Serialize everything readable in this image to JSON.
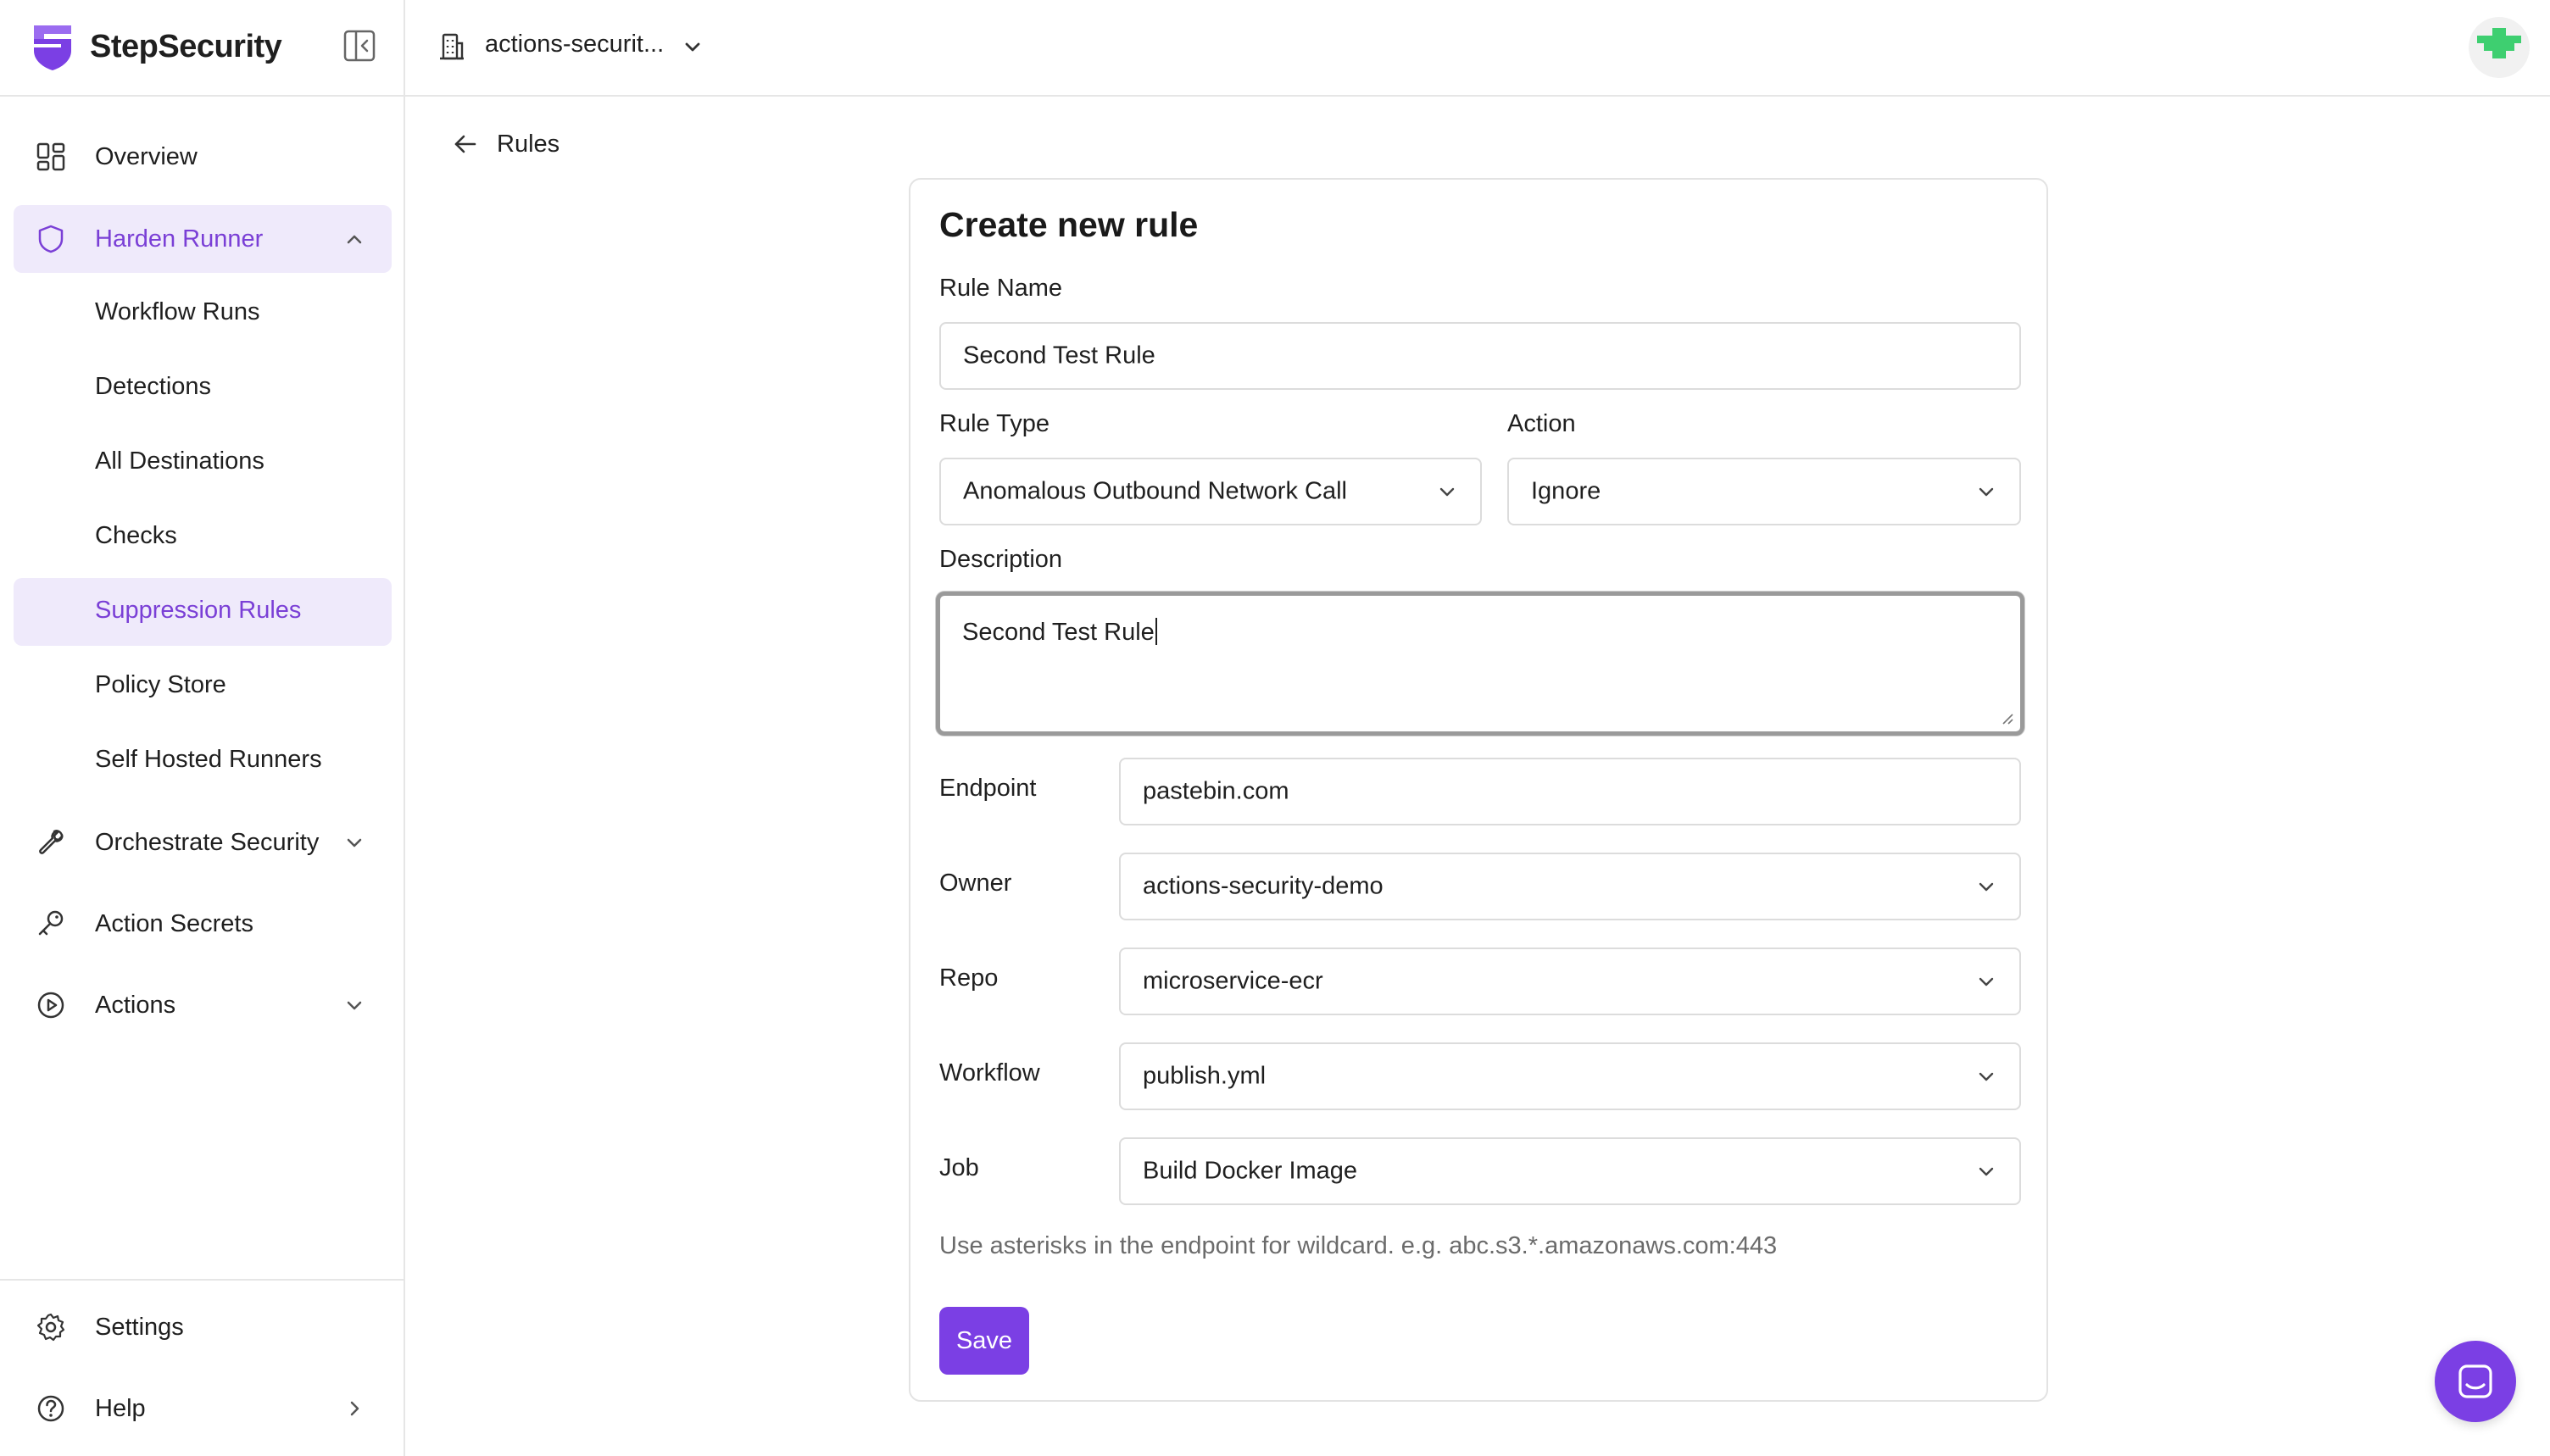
{
  "app": {
    "brand": "StepSecurity",
    "accent": "#7b3fe4"
  },
  "topbar": {
    "org_name": "actions-securit..."
  },
  "sidebar": {
    "items": [
      {
        "label": "Overview",
        "icon": "grid-icon"
      },
      {
        "label": "Harden Runner",
        "icon": "shield-icon",
        "expanded": true
      },
      {
        "label": "Workflow Runs"
      },
      {
        "label": "Detections"
      },
      {
        "label": "All Destinations"
      },
      {
        "label": "Checks"
      },
      {
        "label": "Suppression Rules",
        "active": true
      },
      {
        "label": "Policy Store"
      },
      {
        "label": "Self Hosted Runners"
      },
      {
        "label": "Orchestrate Security",
        "icon": "wrench-icon"
      },
      {
        "label": "Action Secrets",
        "icon": "key-icon"
      },
      {
        "label": "Actions",
        "icon": "play-circle-icon"
      }
    ],
    "bottom": [
      {
        "label": "Settings",
        "icon": "gear-icon"
      },
      {
        "label": "Help",
        "icon": "help-circle-icon"
      }
    ]
  },
  "main": {
    "back_label": "Rules",
    "form": {
      "title": "Create new rule",
      "rule_name": {
        "label": "Rule Name",
        "value": "Second Test Rule"
      },
      "rule_type": {
        "label": "Rule Type",
        "value": "Anomalous Outbound Network Call"
      },
      "action": {
        "label": "Action",
        "value": "Ignore"
      },
      "description": {
        "label": "Description",
        "value": "Second Test Rule"
      },
      "endpoint": {
        "label": "Endpoint",
        "value": "pastebin.com"
      },
      "owner": {
        "label": "Owner",
        "value": "actions-security-demo"
      },
      "repo": {
        "label": "Repo",
        "value": "microservice-ecr"
      },
      "workflow": {
        "label": "Workflow",
        "value": "publish.yml"
      },
      "job": {
        "label": "Job",
        "value": "Build Docker Image"
      },
      "hint": "Use asterisks in the endpoint for wildcard. e.g. abc.s3.*.amazonaws.com:443",
      "save_label": "Save"
    }
  }
}
